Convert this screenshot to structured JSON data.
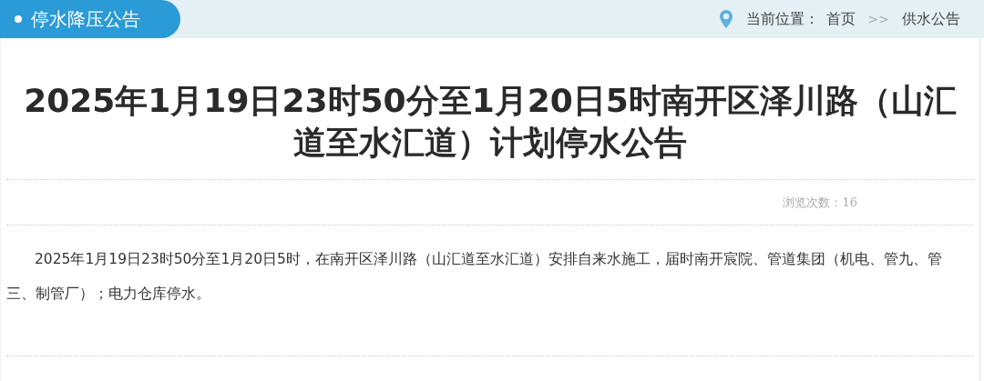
{
  "header": {
    "section_title": "停水降压公告",
    "breadcrumb": {
      "label": "当前位置：",
      "separator": ">>",
      "items": [
        "首页",
        "供水公告"
      ]
    }
  },
  "article": {
    "title": "2025年1月19日23时50分至1月20日5时南开区泽川路（山汇道至水汇道）计划停水公告",
    "views": "浏览次数：16",
    "body": "2025年1月19日23时50分至1月20日5时，在南开区泽川路（山汇道至水汇道）安排自来水施工，届时南开宸院、管道集团（机电、管九、管三、制管厂）；电力仓库停水。"
  }
}
